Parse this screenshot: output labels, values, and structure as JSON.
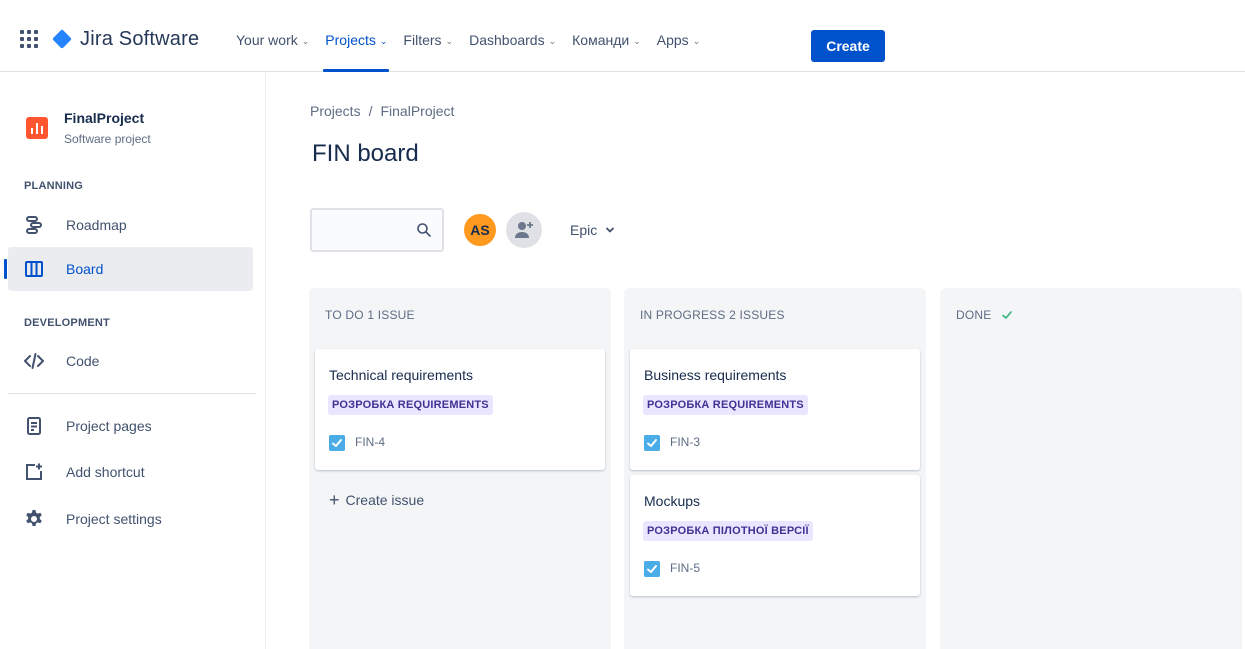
{
  "nav": {
    "logo_text": "Jira Software",
    "items": [
      {
        "label": "Your work",
        "active": false
      },
      {
        "label": "Projects",
        "active": true
      },
      {
        "label": "Filters",
        "active": false
      },
      {
        "label": "Dashboards",
        "active": false
      },
      {
        "label": "Команди",
        "active": false
      },
      {
        "label": "Apps",
        "active": false
      }
    ],
    "create_label": "Create",
    "accent_color": "#0052cc"
  },
  "sidebar": {
    "project_name": "FinalProject",
    "project_type": "Software project",
    "planning_label": "PLANNING",
    "development_label": "DEVELOPMENT",
    "items": {
      "roadmap": "Roadmap",
      "board": "Board",
      "code": "Code",
      "project_pages": "Project pages",
      "add_shortcut": "Add shortcut",
      "project_settings": "Project settings"
    },
    "active_item": "board"
  },
  "main": {
    "breadcrumb": {
      "root": "Projects",
      "separator": "/",
      "current": "FinalProject"
    },
    "title": "FIN board",
    "search_placeholder": "",
    "avatar_initials": "AS",
    "epic_filter_label": "Epic"
  },
  "columns": [
    {
      "heading": "TO DO 1 ISSUE",
      "cards": [
        {
          "title": "Technical requirements",
          "epic": "РОЗРОБКА REQUIREMENTS",
          "key": "FIN-4"
        }
      ],
      "create_issue_label": "Create issue"
    },
    {
      "heading": "IN PROGRESS 2 ISSUES",
      "cards": [
        {
          "title": "Business requirements",
          "epic": "РОЗРОБКА REQUIREMENTS",
          "key": "FIN-3"
        },
        {
          "title": "Mockups",
          "epic": "РОЗРОБКА ПІЛОТНОЇ ВЕРСІЇ",
          "key": "FIN-5"
        }
      ]
    },
    {
      "heading": "DONE",
      "cards": []
    }
  ]
}
